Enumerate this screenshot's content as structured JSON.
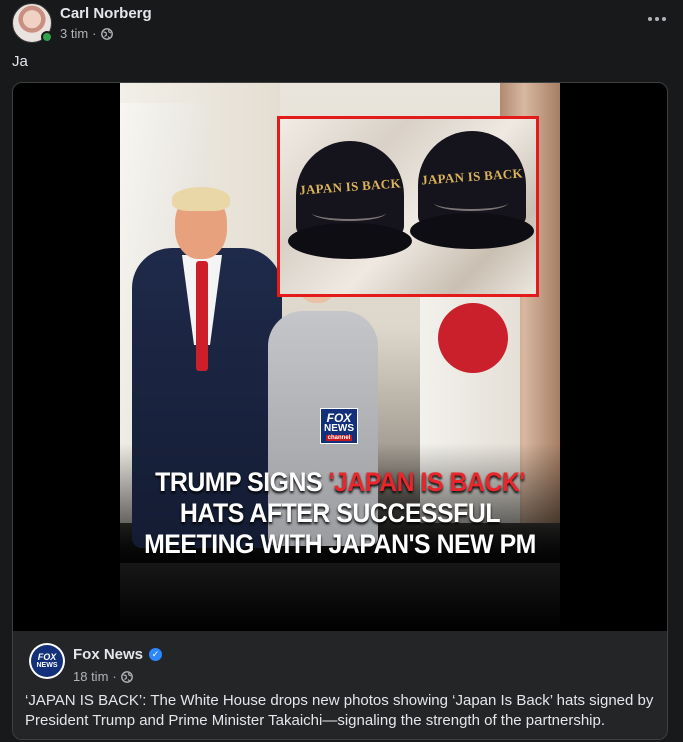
{
  "post": {
    "author": "Carl Norberg",
    "time": "3 tim",
    "separator": "·",
    "text": "Ja",
    "icons": {
      "visibility": "globe-icon",
      "more": "more-options-icon"
    }
  },
  "shared": {
    "image_headline_pre": "TRUMP SIGNS ",
    "image_headline_accent": "'JAPAN IS BACK'",
    "image_headline_post": " HATS AFTER SUCCESSFUL MEETING WITH JAPAN'S NEW PM",
    "hat_left_text": "JAPAN IS BACK",
    "hat_right_text": "JAPAN IS BACK",
    "source_name": "Fox News",
    "source_time": "18 tim",
    "separator": "·",
    "caption": "‘JAPAN IS BACK’: The White House drops new photos showing ‘Japan Is Back’ hats signed by President Trump and Prime Minister Takaichi—signaling the strength of the partnership.",
    "verified": true
  },
  "colors": {
    "background": "#18191a",
    "card": "#242526",
    "text_primary": "#e4e6eb",
    "text_secondary": "#b0b3b8",
    "online": "#31a24c",
    "verified": "#2d88ff",
    "headline_accent": "#e8262b"
  }
}
